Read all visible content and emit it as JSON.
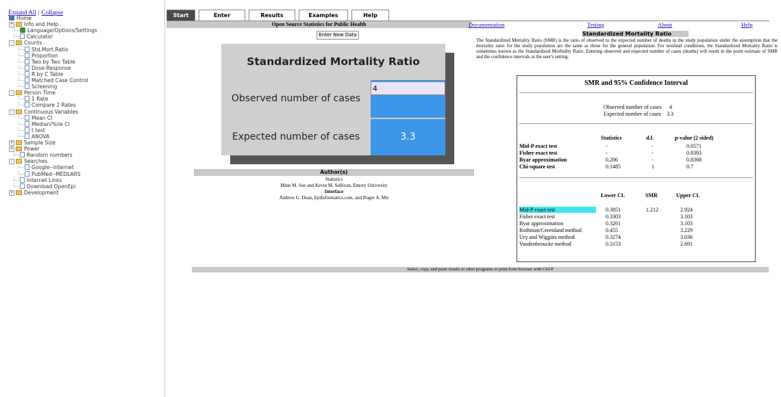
{
  "sidebar": {
    "expand_all": "Expand All",
    "collapse": "Collapse",
    "items": [
      {
        "label": "Home",
        "icon": "home-icon",
        "indent": 0,
        "toggle": ""
      },
      {
        "label": "Info and Help",
        "icon": "folder-icon",
        "indent": 0,
        "toggle": "+"
      },
      {
        "label": "Language/Options/Settings",
        "icon": "settings-icon",
        "indent": 1,
        "toggle": ""
      },
      {
        "label": "Calculator",
        "icon": "page-icon",
        "indent": 1,
        "toggle": ""
      },
      {
        "label": "Counts",
        "icon": "folder-icon",
        "indent": 0,
        "toggle": "-"
      },
      {
        "label": "Std.Mort.Ratio",
        "icon": "page-icon",
        "indent": 2,
        "toggle": ""
      },
      {
        "label": "Proportion",
        "icon": "page-icon",
        "indent": 2,
        "toggle": ""
      },
      {
        "label": "Two by Two Table",
        "icon": "page-icon",
        "indent": 2,
        "toggle": ""
      },
      {
        "label": "Dose-Response",
        "icon": "page-icon",
        "indent": 2,
        "toggle": ""
      },
      {
        "label": "R by C Table",
        "icon": "page-icon",
        "indent": 2,
        "toggle": ""
      },
      {
        "label": "Matched Case Control",
        "icon": "page-icon",
        "indent": 2,
        "toggle": ""
      },
      {
        "label": "Screening",
        "icon": "page-icon",
        "indent": 2,
        "toggle": ""
      },
      {
        "label": "Person Time",
        "icon": "folder-icon",
        "indent": 0,
        "toggle": "-"
      },
      {
        "label": "1 Rate",
        "icon": "page-icon",
        "indent": 2,
        "toggle": ""
      },
      {
        "label": "Compare 2 Rates",
        "icon": "page-icon",
        "indent": 2,
        "toggle": ""
      },
      {
        "label": "Continuous Variables",
        "icon": "folder-icon",
        "indent": 0,
        "toggle": "-"
      },
      {
        "label": "Mean CI",
        "icon": "page-icon",
        "indent": 2,
        "toggle": ""
      },
      {
        "label": "Median/%ile CI",
        "icon": "page-icon",
        "indent": 2,
        "toggle": ""
      },
      {
        "label": "t test",
        "icon": "page-icon",
        "indent": 2,
        "toggle": ""
      },
      {
        "label": "ANOVA",
        "icon": "page-icon",
        "indent": 2,
        "toggle": ""
      },
      {
        "label": "Sample Size",
        "icon": "folder-icon",
        "indent": 0,
        "toggle": "+"
      },
      {
        "label": "Power",
        "icon": "folder-icon",
        "indent": 0,
        "toggle": "+"
      },
      {
        "label": "Random numbers",
        "icon": "page-icon",
        "indent": 1,
        "toggle": ""
      },
      {
        "label": "Searches",
        "icon": "folder-icon",
        "indent": 0,
        "toggle": "-"
      },
      {
        "label": "Google--Internet",
        "icon": "page-icon",
        "indent": 2,
        "toggle": ""
      },
      {
        "label": "PubMed--MEDLARS",
        "icon": "page-icon",
        "indent": 2,
        "toggle": ""
      },
      {
        "label": "Internet Links",
        "icon": "page-icon",
        "indent": 1,
        "toggle": ""
      },
      {
        "label": "Download OpenEpi",
        "icon": "page-icon",
        "indent": 1,
        "toggle": ""
      },
      {
        "label": "Development",
        "icon": "folder-icon",
        "indent": 0,
        "toggle": "+"
      }
    ]
  },
  "tabs": [
    {
      "label": "Start",
      "active": true
    },
    {
      "label": "Enter",
      "active": false
    },
    {
      "label": "Results",
      "active": false
    },
    {
      "label": "Examples",
      "active": false
    },
    {
      "label": "Help",
      "active": false
    }
  ],
  "header": {
    "title": "Open Source Statistics for Public Health",
    "links": [
      "Documentation",
      "Testing",
      "About",
      "Help"
    ]
  },
  "entry": {
    "button": "Enter New Data",
    "panel_title": "Standardized Mortality Ratio",
    "observed_label": "Observed number of cases",
    "observed_value": "4",
    "expected_label": "Expected number of cases",
    "expected_value": "3.3"
  },
  "authors": {
    "heading": "Author(s)",
    "statistics_label": "Statistics",
    "statistics_names": "Minn M. Soe and Kevin M. Sullivan, Emory University",
    "interface_label": "Interface",
    "interface_names": "Andrew G. Dean, EpiInformatics.com, and Roger A. Mir"
  },
  "description": {
    "title": "Standardized Mortality Ratio",
    "text": "The Standardized Mortality Ratio (SMR) is the ratio of observed to the expected number of deaths in the study population under the assumption that the mortality rates for the study population are the same as those for the general population. For nonfatal conditions, the Standardized Mortality Ratio is sometimes known as the Standardized Morbidity Ratio. Entering observed and expected number of cases (deaths) will result in the point estimate of SMR and the confidence intervals at the user's setting."
  },
  "results": {
    "title": "SMR and 95% Confidence Interval",
    "observed_label": "Observed number of cases",
    "observed_value": "4",
    "expected_label": "Expected number of cases",
    "expected_value": "3.3",
    "stats_headers": [
      "Statistics",
      "d.f.",
      "p-value (2 sided)"
    ],
    "stats_rows": [
      {
        "name": "Mid-P exact test",
        "stat": "-",
        "df": "-",
        "p": "0.6571"
      },
      {
        "name": "Fisher exact test",
        "stat": "-",
        "df": "-",
        "p": "0.8393"
      },
      {
        "name": "Byar approximation",
        "stat": "0.206",
        "df": "-",
        "p": "0.8368"
      },
      {
        "name": "Chi-square test",
        "stat": "0.1485",
        "df": "1",
        "p": "0.7"
      }
    ],
    "ci_headers": [
      "Lower CL",
      "SMR",
      "Upper CL"
    ],
    "ci_rows": [
      {
        "name": "Mid-P exact test",
        "lower": "0.3851",
        "smr": "1.212",
        "upper": "2.924",
        "highlight": true
      },
      {
        "name": "Fisher exact test",
        "lower": "0.3303",
        "smr": "",
        "upper": "3.103",
        "highlight": false
      },
      {
        "name": "Byar approximation",
        "lower": "0.3261",
        "smr": "",
        "upper": "3.103",
        "highlight": false
      },
      {
        "name": "Rothman/Greenland method",
        "lower": "0.455",
        "smr": "",
        "upper": "3.229",
        "highlight": false
      },
      {
        "name": "Ury and Wiggins method",
        "lower": "0.3274",
        "smr": "",
        "upper": "3.036",
        "highlight": false
      },
      {
        "name": "Vandenbroucke method",
        "lower": "0.3153",
        "smr": "",
        "upper": "2.691",
        "highlight": false
      }
    ]
  },
  "footer": "Select, copy, and paste results to other programs or print from browser with Ctrl-P",
  "colors": {
    "accent": "#3d95e8",
    "highlight": "#3fe6ec",
    "tab_active": "#4a4a4a"
  }
}
